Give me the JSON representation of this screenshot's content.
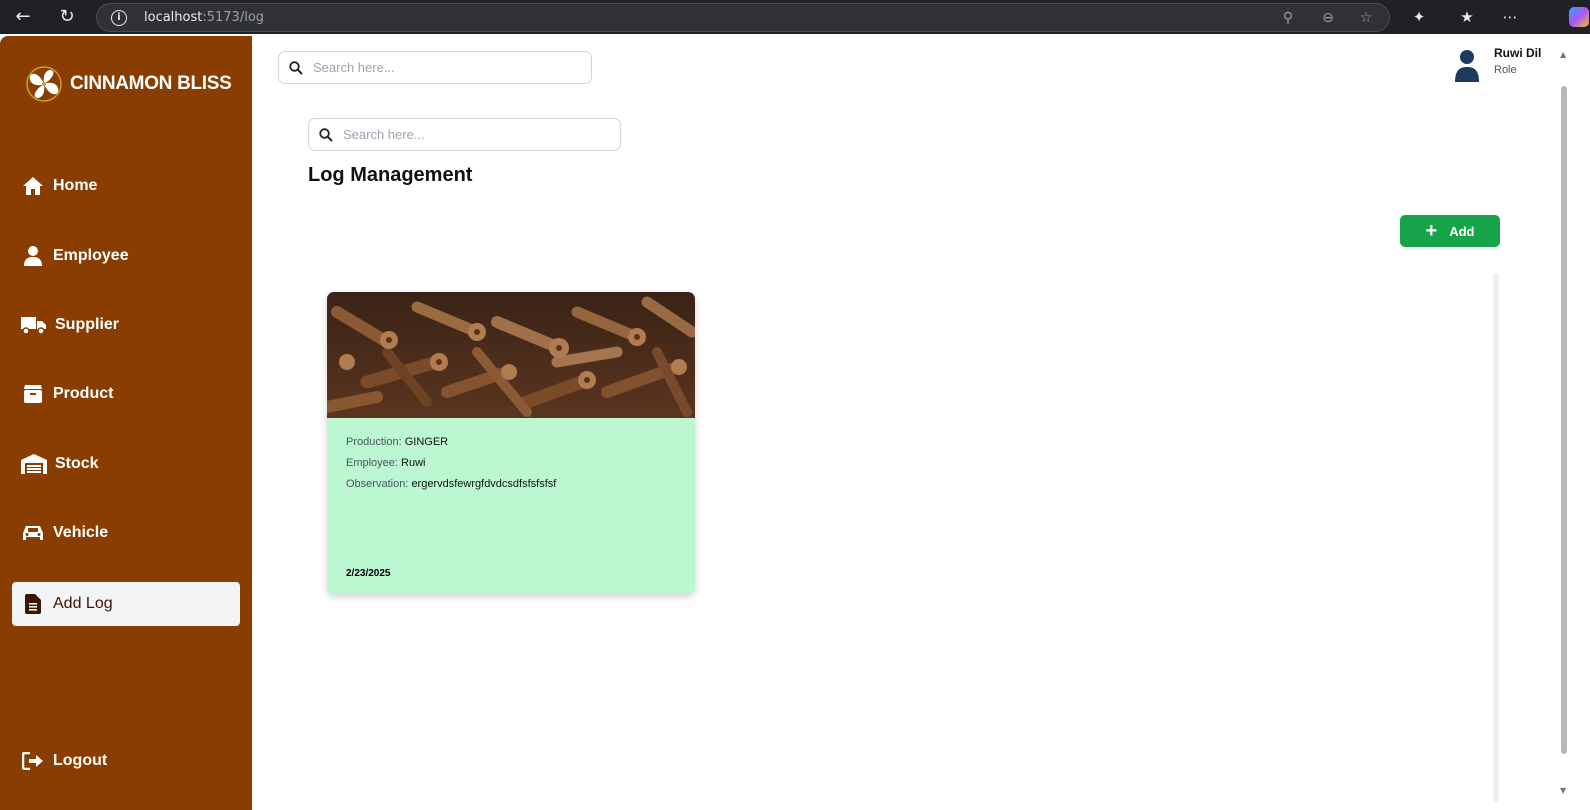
{
  "browser": {
    "url_host": "localhost",
    "url_path": ":5173/log"
  },
  "brand": {
    "name": "CINNAMON BLISS"
  },
  "sidebar": {
    "items": [
      {
        "label": "Home",
        "icon": "home-icon"
      },
      {
        "label": "Employee",
        "icon": "user-icon"
      },
      {
        "label": "Supplier",
        "icon": "truck-icon"
      },
      {
        "label": "Product",
        "icon": "box-icon"
      },
      {
        "label": "Stock",
        "icon": "warehouse-icon"
      },
      {
        "label": "Vehicle",
        "icon": "car-icon"
      },
      {
        "label": "Add Log",
        "icon": "file-icon",
        "active": true
      }
    ],
    "logout_label": "Logout"
  },
  "header": {
    "search_placeholder": "Search here...",
    "user_name": "Ruwi Dil",
    "user_role": "Role"
  },
  "main": {
    "search_placeholder": "Search here...",
    "title": "Log Management",
    "add_label": "Add"
  },
  "logs": [
    {
      "production_label": "Production:",
      "production": "GINGER",
      "employee_label": "Employee:",
      "employee": "Ruwi",
      "observation_label": "Observation:",
      "observation": "ergervdsfewrgfdvdcsdfsfsfsfsf",
      "date": "2/23/2025"
    }
  ],
  "colors": {
    "sidebar_bg": "#8a3d00",
    "card_bg": "#bbf7d0",
    "add_button": "#16a34a",
    "active_item_bg": "#f3f4f6"
  }
}
